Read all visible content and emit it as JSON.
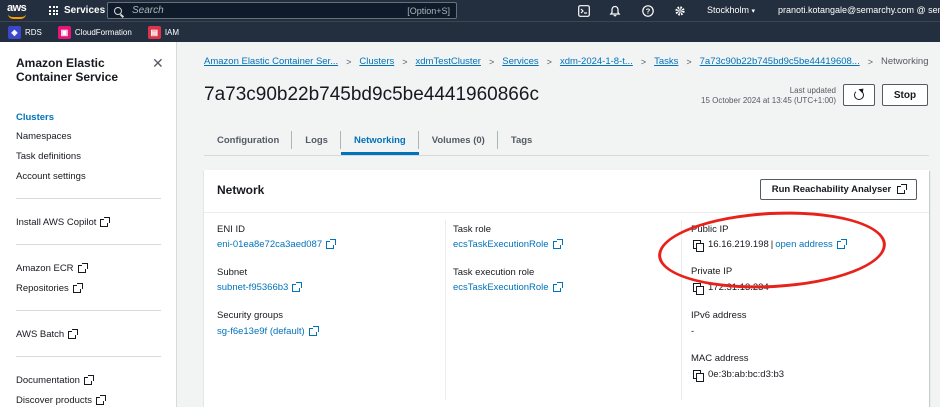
{
  "topnav": {
    "logo": "aws",
    "services_label": "Services",
    "search_placeholder": "Search",
    "search_shortcut": "[Option+S]",
    "region": "Stockholm",
    "account": "pranoti.kotangale@semarchy.com @ semarch"
  },
  "favorites": [
    {
      "label": "RDS",
      "icon": "rds-icon",
      "color": "#3b48cc"
    },
    {
      "label": "CloudFormation",
      "icon": "cloudformation-icon",
      "color": "#e7157b"
    },
    {
      "label": "IAM",
      "icon": "iam-icon",
      "color": "#dd344c"
    }
  ],
  "sidebar": {
    "title": "Amazon Elastic Container Service",
    "items": [
      {
        "label": "Clusters"
      },
      {
        "label": "Namespaces"
      },
      {
        "label": "Task definitions"
      },
      {
        "label": "Account settings"
      },
      {
        "label": "Install AWS Copilot"
      },
      {
        "label": "Amazon ECR"
      },
      {
        "label": "Repositories"
      },
      {
        "label": "AWS Batch"
      },
      {
        "label": "Documentation"
      },
      {
        "label": "Discover products"
      }
    ]
  },
  "breadcrumb": {
    "items": [
      "Amazon Elastic Container Ser...",
      "Clusters",
      "xdmTestCluster",
      "Services",
      "xdm-2024-1-8-t...",
      "Tasks",
      "7a73c90b22b745bd9c5be44419608..."
    ],
    "current": "Networking"
  },
  "page": {
    "title": "7a73c90b22b745bd9c5be4441960866c",
    "last_updated_label": "Last updated",
    "last_updated_value": "15 October 2024 at 13:45 (UTC+1:00)",
    "stop_label": "Stop"
  },
  "tabs": [
    {
      "label": "Configuration"
    },
    {
      "label": "Logs"
    },
    {
      "label": "Networking"
    },
    {
      "label": "Volumes (0)"
    },
    {
      "label": "Tags"
    }
  ],
  "network": {
    "title": "Network",
    "reach_button": "Run Reachability Analyser",
    "eni_label": "ENI ID",
    "eni_value": "eni-01ea8e72ca3aed087",
    "subnet_label": "Subnet",
    "subnet_value": "subnet-f95366b3",
    "sg_label": "Security groups",
    "sg_value": "sg-f6e13e9f (default)",
    "task_role_label": "Task role",
    "task_role_value": "ecsTaskExecutionRole",
    "exec_role_label": "Task execution role",
    "exec_role_value": "ecsTaskExecutionRole",
    "public_ip_label": "Public IP",
    "public_ip_value": "16.16.219.198",
    "public_ip_sep": "|",
    "open_address": "open address",
    "private_ip_label": "Private IP",
    "private_ip_value": "172.31.13.234",
    "ipv6_label": "IPv6 address",
    "ipv6_value": "-",
    "mac_label": "MAC address",
    "mac_value": "0e:3b:ab:bc:d3:b3"
  },
  "colors": {
    "nav_bg": "#232f3e",
    "link": "#0073bb",
    "annotation": "#e8221b",
    "brand_orange": "#ff9900"
  }
}
